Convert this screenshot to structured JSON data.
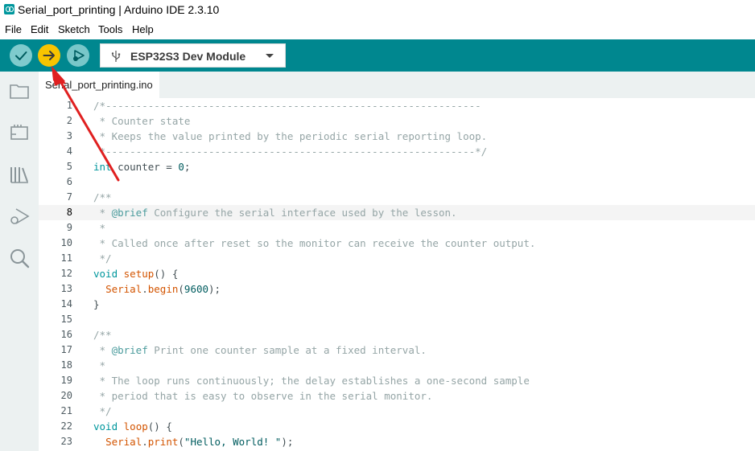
{
  "window": {
    "title": "Serial_port_printing | Arduino IDE 2.3.10"
  },
  "menu": [
    "File",
    "Edit",
    "Sketch",
    "Tools",
    "Help"
  ],
  "toolbar": {
    "board": "ESP32S3 Dev Module",
    "accent": "#00878f",
    "upload_color": "#f8c400"
  },
  "sidebar": {
    "icons": [
      "folder-icon",
      "board-manager-icon",
      "library-icon",
      "debug-icon",
      "search-icon"
    ]
  },
  "tab": {
    "label": "Serial_port_printing.ino"
  },
  "editor": {
    "current_line": 8,
    "lines": [
      "/*--------------------------------------------------------------",
      " * Counter state",
      " * Keeps the value printed by the periodic serial reporting loop.",
      " *-------------------------------------------------------------*/",
      "int counter = 0;",
      "",
      "/**",
      " * @brief Configure the serial interface used by the lesson.",
      " *",
      " * Called once after reset so the monitor can receive the counter output.",
      " */",
      "void setup() {",
      "  Serial.begin(9600);",
      "}",
      "",
      "/**",
      " * @brief Print one counter sample at a fixed interval.",
      " *",
      " * The loop runs continuously; the delay establishes a one-second sample",
      " * period that is easy to observe in the serial monitor.",
      " */",
      "void loop() {",
      "  Serial.print(\"Hello, World! \");"
    ]
  }
}
